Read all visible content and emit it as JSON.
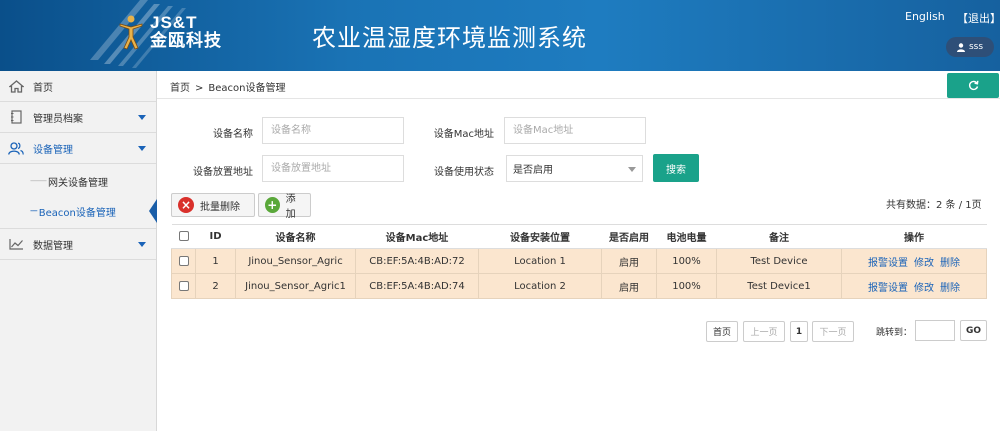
{
  "header": {
    "logo_en": "JS&T",
    "logo_cn": "金瓯科技",
    "title": "农业温湿度环境监测系统",
    "lang_label": "English",
    "logout_label": "【退出】",
    "user_name": "sss",
    "bg_color": "#1a73b5"
  },
  "sidebar": {
    "items": [
      {
        "label": "首页",
        "icon": "home-icon"
      },
      {
        "label": "管理员档案",
        "icon": "book-icon"
      },
      {
        "label": "设备管理",
        "icon": "users-icon"
      },
      {
        "label": "数据管理",
        "icon": "chart-line-icon"
      }
    ],
    "sub_items": [
      {
        "label": "网关设备管理",
        "dash": "——"
      },
      {
        "label": "Beacon设备管理",
        "dash": "---"
      }
    ]
  },
  "breadcrumb": {
    "home": "首页",
    "sep": ">",
    "current": "Beacon设备管理"
  },
  "search": {
    "name_label": "设备名称",
    "name_placeholder": "设备名称",
    "mac_label": "设备Mac地址",
    "mac_placeholder": "设备Mac地址",
    "location_label": "设备放置地址",
    "location_placeholder": "设备放置地址",
    "status_label": "设备使用状态",
    "status_value": "是否启用",
    "search_button": "搜索"
  },
  "actions": {
    "batch_delete": "批量删除",
    "add": "添加"
  },
  "total_info": "共有数据：2 条 / 1页",
  "table": {
    "headers": [
      "ID",
      "设备名称",
      "设备Mac地址",
      "设备安装位置",
      "是否启用",
      "电池电量",
      "备注",
      "操作"
    ],
    "rows": [
      {
        "id": "1",
        "name": "Jinou_Sensor_Agric",
        "mac": "CB:EF:5A:4B:AD:72",
        "location": "Location 1",
        "enabled": "启用",
        "battery": "100%",
        "remark": "Test Device"
      },
      {
        "id": "2",
        "name": "Jinou_Sensor_Agric1",
        "mac": "CB:EF:5A:4B:AD:74",
        "location": "Location 2",
        "enabled": "启用",
        "battery": "100%",
        "remark": "Test Device1"
      }
    ],
    "ops": {
      "alarm": "报警设置",
      "edit": "修改",
      "delete": "删除"
    }
  },
  "pagination": {
    "first": "首页",
    "prev": "上一页",
    "current": "1",
    "next": "下一页",
    "jump_label": "跳转到：",
    "go": "GO"
  },
  "colors": {
    "accent": "#1aa28a",
    "link": "#1a63b8",
    "row_bg": "#fbe6cf"
  }
}
